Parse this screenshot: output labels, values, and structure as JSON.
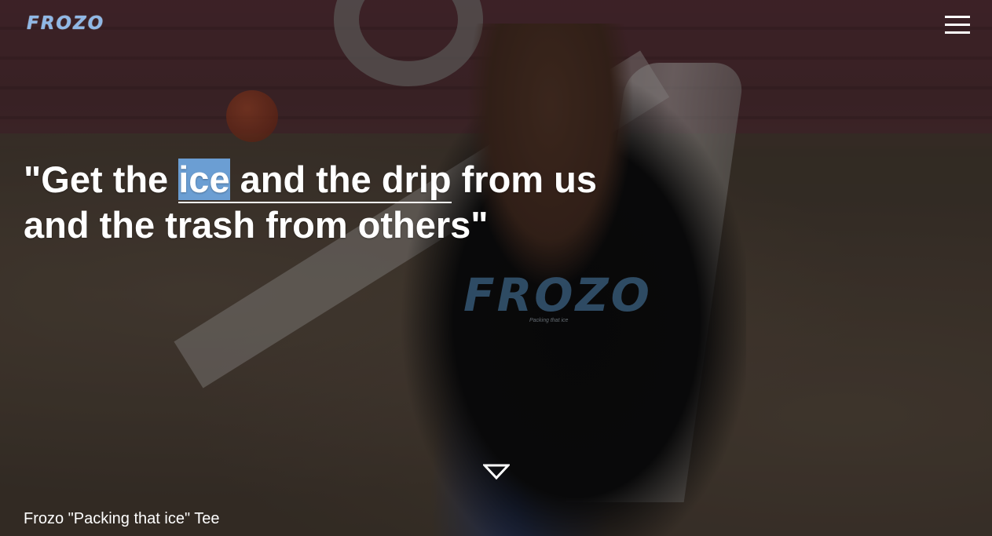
{
  "header": {
    "logo_text": "FROZO",
    "menu_icon": "hamburger-icon"
  },
  "hero": {
    "quote_open": "\"Get the ",
    "quote_highlight": "ice",
    "quote_link_rest": " and the drip",
    "quote_after_link": " from us and the trash from others\"",
    "scroll_icon": "triangle-down-icon",
    "shirt_logo": "FROZO",
    "shirt_tagline": "Packing that ice"
  },
  "caption": {
    "product_name": "Frozo \"Packing that ice\" Tee"
  },
  "colors": {
    "logo": "#8fb8e6",
    "highlight": "#6b9ed3",
    "text": "#ffffff"
  }
}
